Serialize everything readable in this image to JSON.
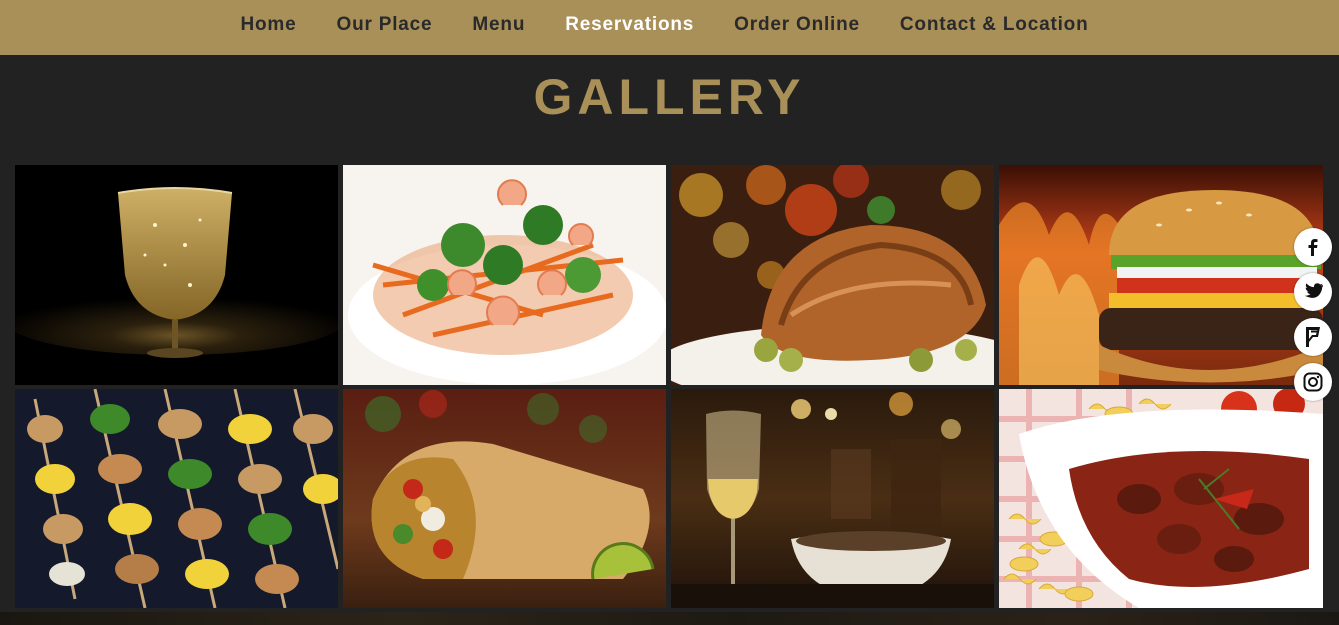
{
  "nav": {
    "items": [
      {
        "label": "Home",
        "active": false
      },
      {
        "label": "Our Place",
        "active": false
      },
      {
        "label": "Menu",
        "active": false
      },
      {
        "label": "Reservations",
        "active": true
      },
      {
        "label": "Order Online",
        "active": false
      },
      {
        "label": "Contact & Location",
        "active": false
      }
    ]
  },
  "gallery": {
    "title": "GALLERY",
    "images": [
      {
        "subject": "champagne-glass"
      },
      {
        "subject": "shrimp-salad"
      },
      {
        "subject": "roast-chicken"
      },
      {
        "subject": "burger-flames"
      },
      {
        "subject": "chicken-skewers"
      },
      {
        "subject": "burrito"
      },
      {
        "subject": "wine-glass-restaurant"
      },
      {
        "subject": "beef-stew-pasta"
      }
    ]
  },
  "social": {
    "icons": [
      "facebook-icon",
      "twitter-icon",
      "foursquare-icon",
      "instagram-icon"
    ]
  },
  "colors": {
    "accent": "#a89058",
    "background": "#222222",
    "nav_text": "#2a2a2a",
    "nav_active": "#ffffff"
  }
}
